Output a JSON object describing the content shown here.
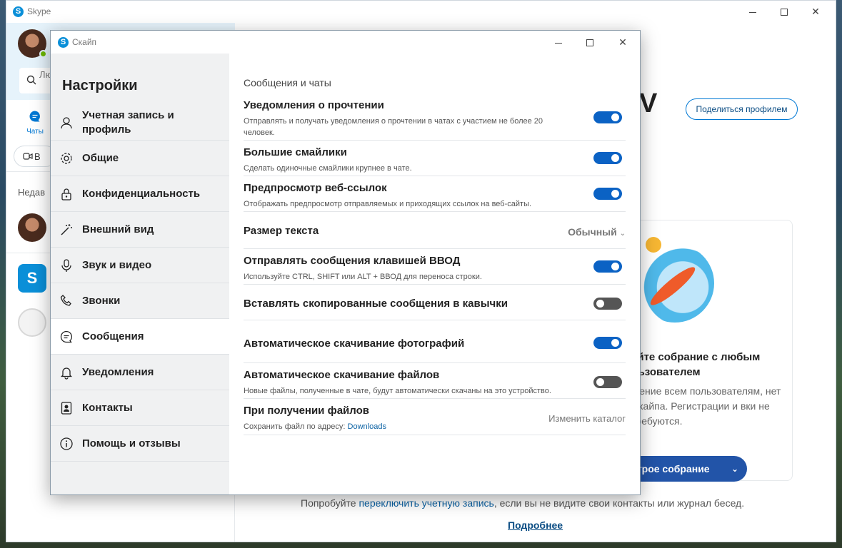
{
  "main_window": {
    "title": "Skype",
    "search_placeholder": "Лю... инт...",
    "nav_chats_label": "Чаты",
    "meet_button": "В",
    "recent_label": "Недав",
    "big_letter": "V",
    "share_profile_button": "Поделиться профилем",
    "card_title": "уйте собрание с любым льзователем",
    "card_desc": "шение всем пользователям, нет Скайпа. Регистрации и вки не требуются.",
    "quick_meet_button": "строе собрание",
    "switch_prefix": "Попробуйте ",
    "switch_link": "переключить учетную запись",
    "switch_suffix": ", если вы не видите свои контакты или журнал бесед.",
    "more_link": "Подробнее"
  },
  "dialog": {
    "title": "Скайп",
    "sidebar_title": "Настройки",
    "menu": [
      {
        "label": "Учетная запись и профиль",
        "icon": "person-icon"
      },
      {
        "label": "Общие",
        "icon": "gear-icon"
      },
      {
        "label": "Конфиденциальность",
        "icon": "lock-icon"
      },
      {
        "label": "Внешний вид",
        "icon": "magic-wand-icon"
      },
      {
        "label": "Звук и видео",
        "icon": "microphone-icon"
      },
      {
        "label": "Звонки",
        "icon": "phone-icon"
      },
      {
        "label": "Сообщения",
        "icon": "chat-bubble-icon",
        "active": true
      },
      {
        "label": "Уведомления",
        "icon": "bell-icon"
      },
      {
        "label": "Контакты",
        "icon": "contact-card-icon"
      },
      {
        "label": "Помощь и отзывы",
        "icon": "info-icon"
      }
    ],
    "section_title": "Сообщения и чаты",
    "settings": [
      {
        "title": "Уведомления о прочтении",
        "desc": "Отправлять и получать уведомления о прочтении в чатах с участием не более 20 человек.",
        "toggle": true
      },
      {
        "title": "Большие смайлики",
        "desc": "Сделать одиночные смайлики крупнее в чате.",
        "toggle": true
      },
      {
        "title": "Предпросмотр веб-ссылок",
        "desc": "Отображать предпросмотр отправляемых и приходящих ссылок на веб-сайты.",
        "toggle": true
      },
      {
        "title": "Размер текста",
        "value": "Обычный"
      },
      {
        "title": "Отправлять сообщения клавишей ВВОД",
        "desc": "Используйте CTRL, SHIFT или ALT + ВВОД для переноса строки.",
        "toggle": true
      },
      {
        "title": "Вставлять скопированные сообщения в кавычки",
        "toggle": false
      },
      {
        "title": "Автоматическое скачивание фотографий",
        "toggle": true
      },
      {
        "title": "Автоматическое скачивание файлов",
        "desc": "Новые файлы, полученные в чате, будут автоматически скачаны на это устройство.",
        "toggle": false
      },
      {
        "title": "При получении файлов",
        "desc_prefix": "Сохранить файл по адресу: ",
        "desc_link": "Downloads",
        "value": "Изменить каталог"
      }
    ]
  },
  "colors": {
    "toggle_on": "#0b62c4",
    "toggle_off": "#555555",
    "link": "#0b62a4",
    "accent": "#0078d4"
  }
}
